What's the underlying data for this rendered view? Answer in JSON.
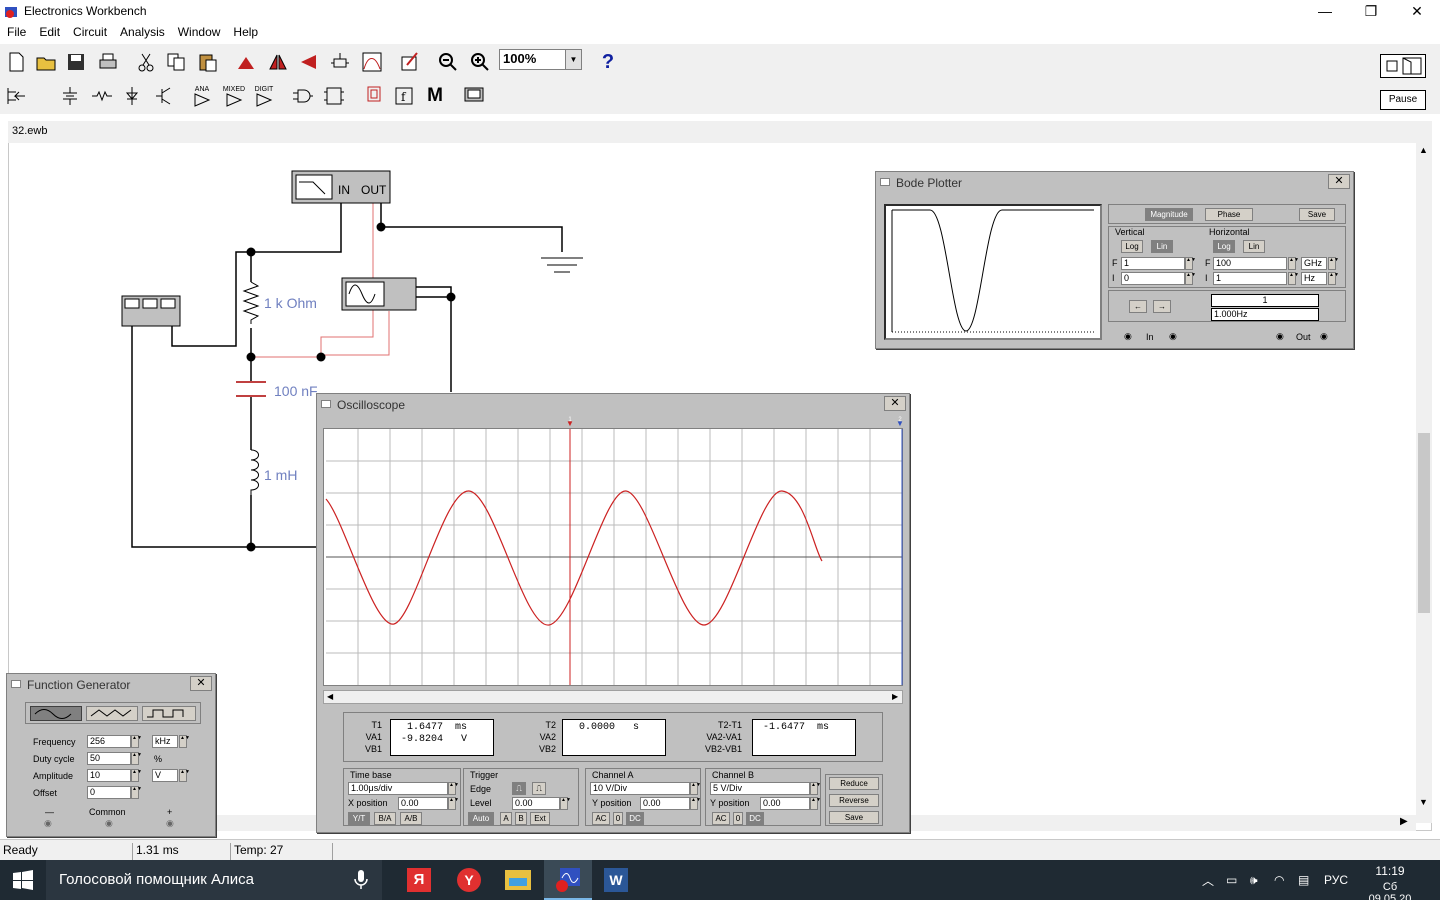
{
  "app": {
    "title": "Electronics Workbench"
  },
  "window_controls": {
    "minimize": "—",
    "restore": "❐",
    "close": "✕"
  },
  "menu": [
    "File",
    "Edit",
    "Circuit",
    "Analysis",
    "Window",
    "Help"
  ],
  "toolbar": {
    "zoom_value": "100%",
    "help_label": "?",
    "pause_label": "Pause",
    "parts_labels": {
      "ana": "ANA",
      "mixed": "MIXED",
      "digit": "DIGIT",
      "m": "M"
    }
  },
  "document": {
    "title": "32.ewb"
  },
  "circuit": {
    "resistor_label": "1 k Ohm",
    "capacitor_label": "100 nF",
    "inductor_label": "1 mH",
    "bode_in": "IN",
    "bode_out": "OUT"
  },
  "bode": {
    "title": "Bode Plotter",
    "magnitude": "Magnitude",
    "phase": "Phase",
    "save": "Save",
    "vertical": "Vertical",
    "horizontal": "Horizontal",
    "log": "Log",
    "lin": "Lin",
    "f_label": "F",
    "i_label": "I",
    "v_f": "1",
    "v_i": "0",
    "h_f": "100",
    "h_f_unit": "GHz",
    "h_i": "1",
    "h_i_unit": "Hz",
    "readout_top": "1",
    "readout_bottom": "1.000Hz",
    "left_arrow": "←",
    "right_arrow": "→",
    "in_label": "In",
    "out_label": "Out"
  },
  "oscilloscope": {
    "title": "Oscilloscope",
    "t1_labels": "T1\nVA1\nVB1",
    "t1_values": "  1.6477  ms\n -9.8204   V",
    "t2_labels": "T2\nVA2\nVB2",
    "t2_values": "  0.0000   s",
    "dt_labels": "T2-T1\nVA2-VA1\nVB2-VB1",
    "dt_values": " -1.6477  ms",
    "time_base": "Time base",
    "time_base_value": "1.00μs/div",
    "x_position": "X position",
    "x_position_value": "0.00",
    "ya": "Y/T",
    "ba": "B/A",
    "ab": "A/B",
    "trigger": "Trigger",
    "edge": "Edge",
    "level": "Level",
    "level_value": "0.00",
    "auto": "Auto",
    "a": "A",
    "b": "B",
    "ext": "Ext",
    "channel_a": "Channel A",
    "channel_a_value": "10 V/Div",
    "ya_position": "Y position",
    "ya_position_value": "0.00",
    "channel_b": "Channel B",
    "channel_b_value": "5 V/Div",
    "yb_position": "Y position",
    "yb_position_value": "0.00",
    "ac": "AC",
    "zero": "0",
    "dc": "DC",
    "reduce": "Reduce",
    "reverse": "Reverse",
    "save": "Save",
    "cursor1": "1",
    "cursor2": "2"
  },
  "function_generator": {
    "title": "Function Generator",
    "frequency_label": "Frequency",
    "frequency_value": "256",
    "frequency_unit": "kHz",
    "duty_label": "Duty cycle",
    "duty_value": "50",
    "duty_unit": "%",
    "amplitude_label": "Amplitude",
    "amplitude_value": "10",
    "amplitude_unit": "V",
    "offset_label": "Offset",
    "offset_value": "0",
    "minus": "—",
    "common": "Common",
    "plus": "+"
  },
  "status": {
    "ready": "Ready",
    "time": "1.31 ms",
    "temp": "Temp:  27"
  },
  "taskbar": {
    "search_text": "Голосовой помощник Алиса",
    "lang": "РУС",
    "time": "11:19",
    "date": "Сб 09.05.20"
  },
  "colors": {
    "trace": "#cc2222",
    "accent": "#0078d7"
  }
}
